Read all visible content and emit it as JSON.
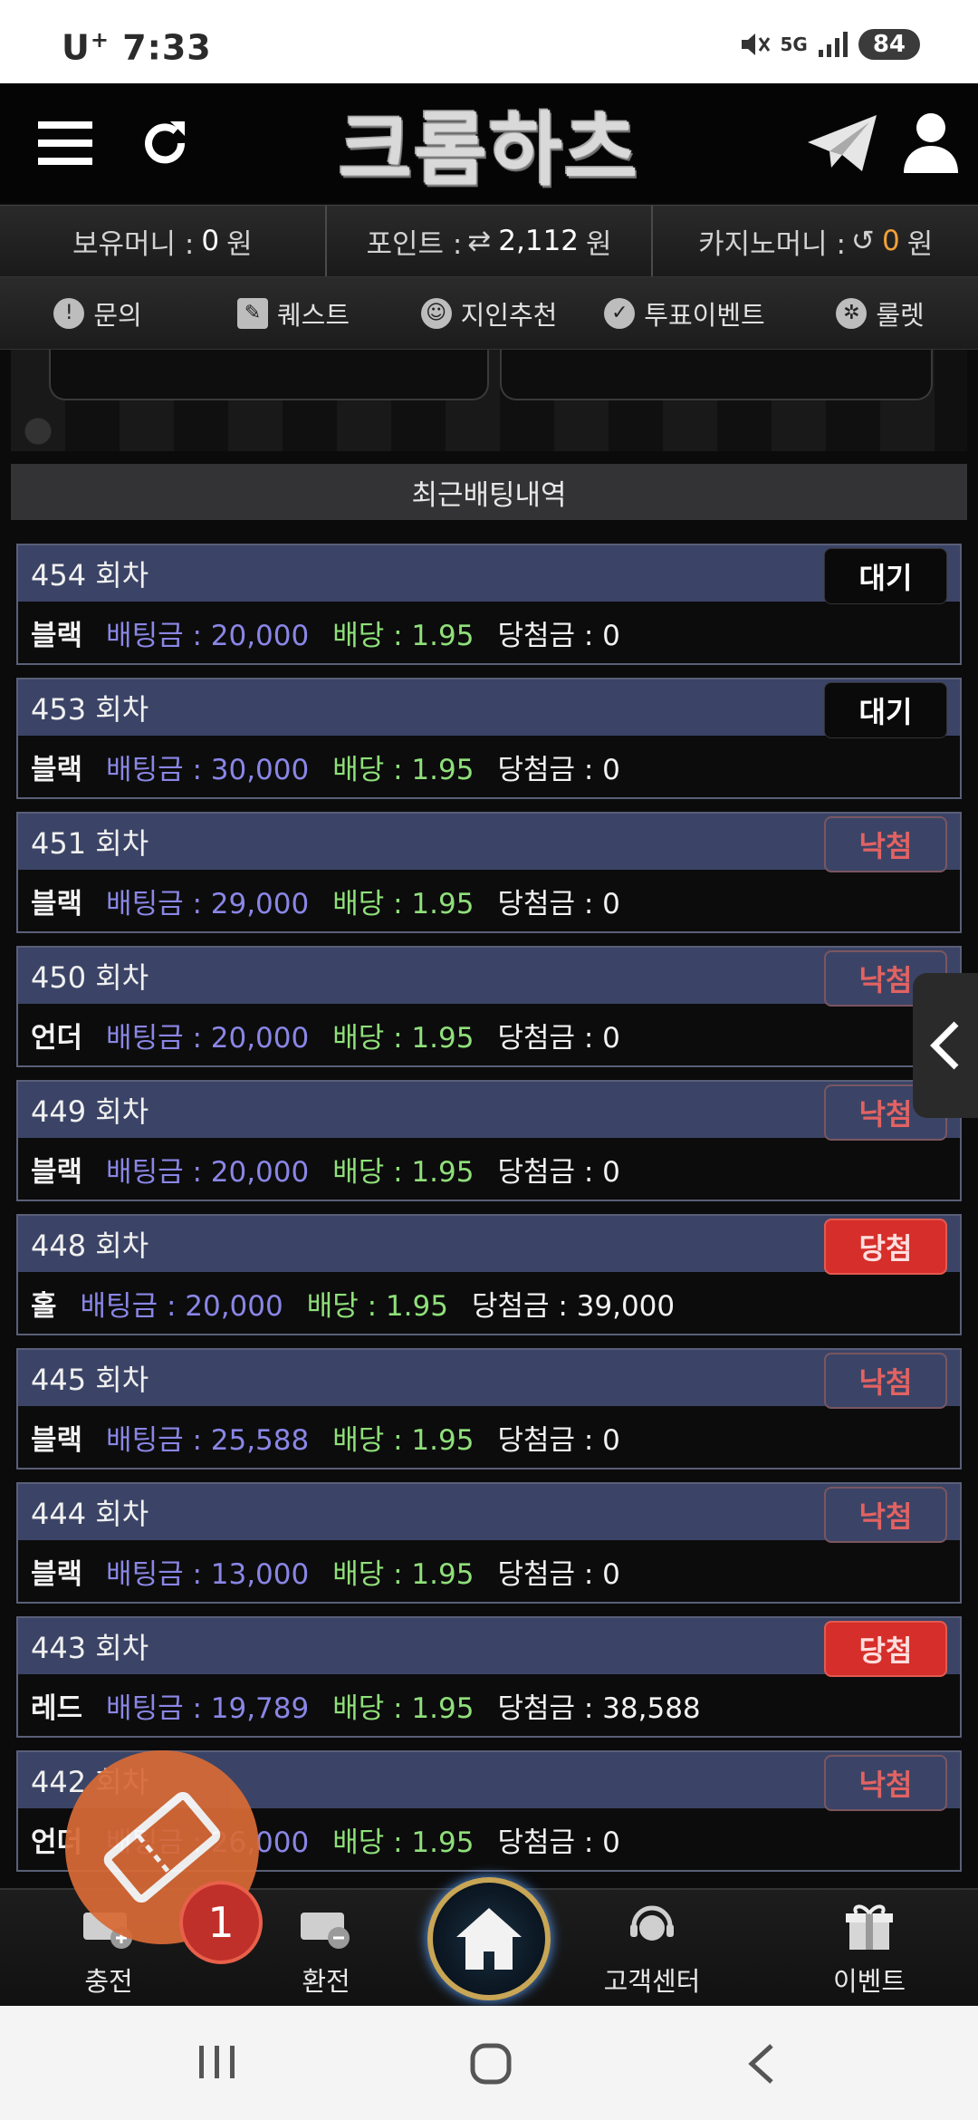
{
  "status": {
    "carrier": "U",
    "carrier_sup": "+",
    "time": "7:33",
    "network": "5G",
    "battery": "84"
  },
  "header": {
    "logo_text": "크롬하츠"
  },
  "money": {
    "holding_label": "보유머니 :",
    "holding_value": "0",
    "holding_unit": "원",
    "point_label": "포인트 :",
    "point_value": "2,112",
    "point_unit": "원",
    "casino_label": "카지노머니 :",
    "casino_value": "0",
    "casino_unit": "원"
  },
  "menu": [
    {
      "label": "문의"
    },
    {
      "label": "퀘스트"
    },
    {
      "label": "지인추천"
    },
    {
      "label": "투표이벤트"
    },
    {
      "label": "룰렛"
    }
  ],
  "section_title": "최근배팅내역",
  "bets": [
    {
      "round": "454 회차",
      "status": "대기",
      "pick": "블랙",
      "amount": "배팅금 : 20,000",
      "odds": "배당 : 1.95",
      "win": "당첨금 : 0"
    },
    {
      "round": "453 회차",
      "status": "대기",
      "pick": "블랙",
      "amount": "배팅금 : 30,000",
      "odds": "배당 : 1.95",
      "win": "당첨금 : 0"
    },
    {
      "round": "451 회차",
      "status": "낙첨",
      "pick": "블랙",
      "amount": "배팅금 : 29,000",
      "odds": "배당 : 1.95",
      "win": "당첨금 : 0"
    },
    {
      "round": "450 회차",
      "status": "낙첨",
      "pick": "언더",
      "amount": "배팅금 : 20,000",
      "odds": "배당 : 1.95",
      "win": "당첨금 : 0"
    },
    {
      "round": "449 회차",
      "status": "낙첨",
      "pick": "블랙",
      "amount": "배팅금 : 20,000",
      "odds": "배당 : 1.95",
      "win": "당첨금 : 0"
    },
    {
      "round": "448 회차",
      "status": "당첨",
      "pick": "홀",
      "amount": "배팅금 : 20,000",
      "odds": "배당 : 1.95",
      "win": "당첨금 : 39,000"
    },
    {
      "round": "445 회차",
      "status": "낙첨",
      "pick": "블랙",
      "amount": "배팅금 : 25,588",
      "odds": "배당 : 1.95",
      "win": "당첨금 : 0"
    },
    {
      "round": "444 회차",
      "status": "낙첨",
      "pick": "블랙",
      "amount": "배팅금 : 13,000",
      "odds": "배당 : 1.95",
      "win": "당첨금 : 0"
    },
    {
      "round": "443 회차",
      "status": "당첨",
      "pick": "레드",
      "amount": "배팅금 : 19,789",
      "odds": "배당 : 1.95",
      "win": "당첨금 : 38,588"
    },
    {
      "round": "442 회차",
      "status": "낙첨",
      "pick": "언더",
      "amount": "배팅금 : 26,000",
      "odds": "배당 : 1.95",
      "win": "당첨금 : 0"
    }
  ],
  "bottom_nav": [
    {
      "label": "충전",
      "icon": "charge-icon"
    },
    {
      "label": "환전",
      "icon": "exchange-icon"
    },
    {
      "label": "",
      "icon": "home-icon"
    },
    {
      "label": "고객센터",
      "icon": "support-icon"
    },
    {
      "label": "이벤트",
      "icon": "gift-icon"
    }
  ],
  "coupon_badge": "1",
  "colors": {
    "row_header": "#3b4466",
    "amount": "#8a86e6",
    "odds": "#8fe07a",
    "lose": "#e26262",
    "win_badge": "#d62e2a",
    "casino_value": "#f0a03a"
  }
}
